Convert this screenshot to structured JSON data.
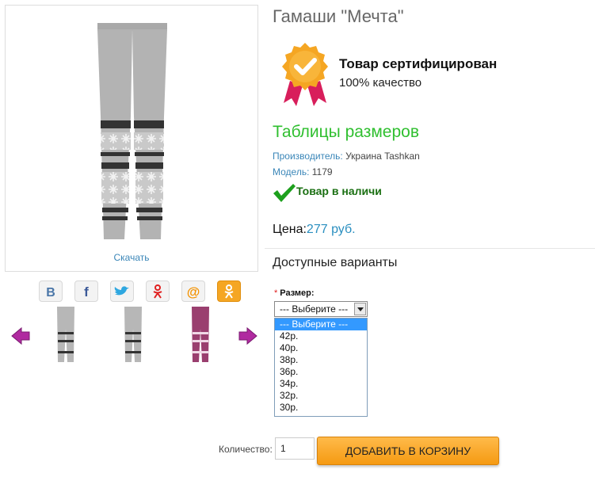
{
  "product": {
    "title": "Гамаши \"Мечта\"",
    "download_label": "Скачать",
    "certificate": {
      "title": "Товар сертифицирован",
      "subtitle": "100% качество"
    },
    "size_table_link": "Таблицы размеров",
    "manufacturer": {
      "label": "Производитель:",
      "value": " Украина Tashkan"
    },
    "model": {
      "label": "Модель:",
      "value": " 1179"
    },
    "stock_status": "Товар в наличи",
    "price": {
      "label": "Цена:",
      "value": "277 руб."
    }
  },
  "social_icons": [
    "vk-icon",
    "facebook-icon",
    "twitter-icon",
    "odnoklassniki-icon",
    "mail-icon",
    "ok-icon"
  ],
  "thumbnails": [
    {
      "name": "gray-leggings-thumb",
      "color": "#b7b7b7"
    },
    {
      "name": "gray-leggings-thumb-2",
      "color": "#b7b7b7"
    },
    {
      "name": "purple-leggings-thumb",
      "color": "#9a3f6f"
    }
  ],
  "options": {
    "heading": "Доступные варианты",
    "size_label": "Размер:",
    "required_mark": "*",
    "selected": "--- Выберите ---",
    "choices": [
      "--- Выберите ---",
      "42р.",
      "40р.",
      "38р.",
      "36р.",
      "34р.",
      "32р.",
      "30р."
    ]
  },
  "cart": {
    "quantity_label": "Количество:",
    "quantity_value": "1",
    "add_button": "ДОБАВИТЬ В КОРЗИНУ"
  },
  "colors": {
    "accent_green": "#2fbf2f",
    "price_blue": "#2a8fc0",
    "button_orange": "#f59a12",
    "arrow_purple": "#b02aa0"
  }
}
